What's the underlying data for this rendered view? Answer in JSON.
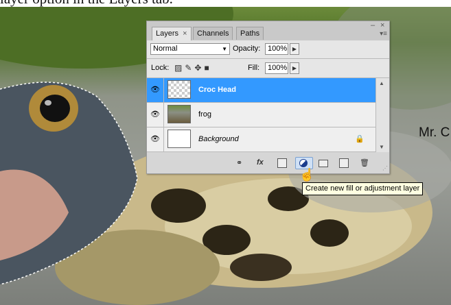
{
  "caption": {
    "text": "layer option in the Layers tab."
  },
  "side_text": "Mr. C",
  "panel": {
    "tabs": [
      {
        "label": "Layers",
        "close": "×",
        "active": true
      },
      {
        "label": "Channels"
      },
      {
        "label": "Paths"
      }
    ],
    "minimize": "–",
    "close": "×",
    "menu": "▾≡",
    "blend_mode": "Normal",
    "opacity_label": "Opacity:",
    "opacity_value": "100%",
    "lock_label": "Lock:",
    "fill_label": "Fill:",
    "fill_value": "100%",
    "layers": [
      {
        "name": "Croc Head",
        "selected": true
      },
      {
        "name": "frog",
        "selected": false
      },
      {
        "name": "Background",
        "selected": false,
        "locked": true
      }
    ],
    "bottom_icons": [
      "link-icon",
      "fx-icon",
      "mask-icon",
      "adjustment-icon",
      "group-icon",
      "new-layer-icon",
      "trash-icon"
    ],
    "fx_text": "fx"
  },
  "tooltip": "Create new fill or adjustment layer",
  "colors": {
    "selection": "#3399ff",
    "tooltip_bg": "#ffffe1",
    "panel_bg": "#d6d6d6"
  }
}
